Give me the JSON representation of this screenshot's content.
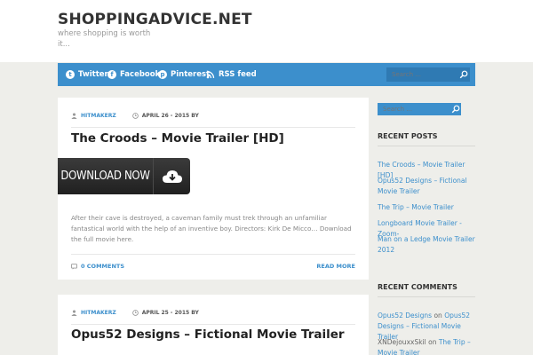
{
  "site": {
    "title": "SHOPPINGADVICE.NET",
    "tagline": "where shopping is worth it..."
  },
  "nav": {
    "items": [
      {
        "label": "Twitter",
        "icon": "twitter-icon"
      },
      {
        "label": "Facebook",
        "icon": "facebook-icon"
      },
      {
        "label": "Pinterest",
        "icon": "pinterest-icon"
      },
      {
        "label": "RSS feed",
        "icon": "rss-icon"
      }
    ],
    "search_placeholder": "Search ..."
  },
  "posts": [
    {
      "author": "HITMAKERZ",
      "date": "APRIL 26 - 2015 BY",
      "title": "The Croods – Movie Trailer [HD]",
      "button_label": "DOWNLOAD NOW",
      "excerpt": "After their cave is destroyed, a caveman family must trek through an unfamiliar fantastical world with the help of an inventive boy. Directors: Kirk De Micco… Download the full movie here.",
      "comments": "0 COMMENTS",
      "read_more": "READ MORE"
    },
    {
      "author": "HITMAKERZ",
      "date": "APRIL 25 - 2015 BY",
      "title": "Opus52 Designs – Fictional Movie Trailer"
    }
  ],
  "sidebar": {
    "search_placeholder": "Search ...",
    "recent_posts_title": "RECENT POSTS",
    "recent_posts": [
      "The Croods – Movie Trailer [HD]",
      "Opus52 Designs – Fictional Movie Trailer",
      "The Trip – Movie Trailer",
      "Longboard Movie Trailer -Zoom-",
      "Man on a Ledge Movie Trailer 2012"
    ],
    "recent_comments_title": "RECENT COMMENTS",
    "recent_comments": [
      {
        "author": "Opus52 Designs",
        "on": "on",
        "post": "Opus52 Designs – Fictional Movie Trailer"
      },
      {
        "author": "XNDejouxxSkil",
        "on": "on",
        "post": "The Trip – Movie Trailer"
      }
    ]
  },
  "colors": {
    "accent": "#3c8fcc",
    "background": "#eeeeea",
    "button_dark": "#2a2a2a"
  }
}
